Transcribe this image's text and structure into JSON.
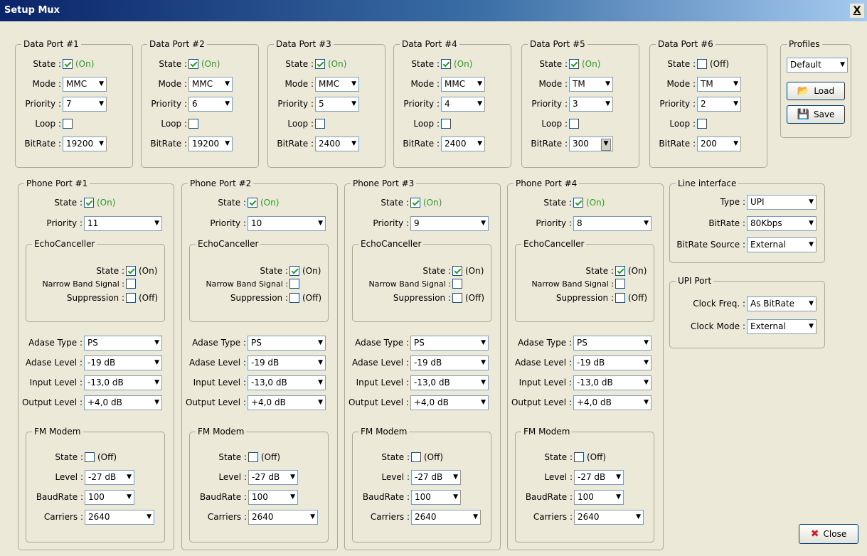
{
  "window": {
    "title": "Setup Mux",
    "close_glyph": "X"
  },
  "data_ports": [
    {
      "title": "Data Port #1",
      "state": "(On)",
      "state_checked": true,
      "mode": "MMC",
      "priority": "7",
      "bitrate": "19200"
    },
    {
      "title": "Data Port #2",
      "state": "(On)",
      "state_checked": true,
      "mode": "MMC",
      "priority": "6",
      "bitrate": "19200"
    },
    {
      "title": "Data Port #3",
      "state": "(On)",
      "state_checked": true,
      "mode": "MMC",
      "priority": "5",
      "bitrate": "2400"
    },
    {
      "title": "Data Port #4",
      "state": "(On)",
      "state_checked": true,
      "mode": "MMC",
      "priority": "4",
      "bitrate": "2400"
    },
    {
      "title": "Data Port #5",
      "state": "(On)",
      "state_checked": true,
      "mode": "TM",
      "priority": "3",
      "bitrate": "300"
    },
    {
      "title": "Data Port #6",
      "state": "(Off)",
      "state_checked": false,
      "mode": "TM",
      "priority": "2",
      "bitrate": "200"
    }
  ],
  "data_labels": {
    "state": "State :",
    "mode": "Mode :",
    "priority": "Priority :",
    "loop": "Loop :",
    "bitrate": "BitRate :"
  },
  "profiles": {
    "title": "Profiles",
    "selected": "Default",
    "load_label": "Load",
    "save_label": "Save"
  },
  "phone_ports": [
    {
      "title": "Phone Port #1",
      "state": "(On)",
      "priority": "11",
      "ec_state": "(On)",
      "suppression": "(Off)",
      "adase_type": "PS",
      "adase_level": "-19 dB",
      "input_level": "-13,0 dB",
      "output_level": "+4,0 dB",
      "fm_state": "(Off)",
      "fm_level": "-27 dB",
      "baudrate": "100",
      "carriers": "2640"
    },
    {
      "title": "Phone Port #2",
      "state": "(On)",
      "priority": "10",
      "ec_state": "(On)",
      "suppression": "(Off)",
      "adase_type": "PS",
      "adase_level": "-19 dB",
      "input_level": "-13,0 dB",
      "output_level": "+4,0 dB",
      "fm_state": "(Off)",
      "fm_level": "-27 dB",
      "baudrate": "100",
      "carriers": "2640"
    },
    {
      "title": "Phone Port #3",
      "state": "(On)",
      "priority": "9",
      "ec_state": "(On)",
      "suppression": "(Off)",
      "adase_type": "PS",
      "adase_level": "-19 dB",
      "input_level": "-13,0 dB",
      "output_level": "+4,0 dB",
      "fm_state": "(Off)",
      "fm_level": "-27 dB",
      "baudrate": "100",
      "carriers": "2640"
    },
    {
      "title": "Phone Port #4",
      "state": "(On)",
      "priority": "8",
      "ec_state": "(On)",
      "suppression": "(Off)",
      "adase_type": "PS",
      "adase_level": "-19 dB",
      "input_level": "-13,0 dB",
      "output_level": "+4,0 dB",
      "fm_state": "(Off)",
      "fm_level": "-27 dB",
      "baudrate": "100",
      "carriers": "2640"
    }
  ],
  "phone_labels": {
    "state": "State :",
    "priority": "Priority :",
    "echo_title": "EchoCanceller",
    "nb_signal": "Narrow Band Signal :",
    "suppression": "Suppression :",
    "adase_type": "Adase Type :",
    "adase_level": "Adase Level :",
    "input_level": "Input Level :",
    "output_level": "Output Level :",
    "fm_title": "FM Modem",
    "fm_level": "Level :",
    "baudrate": "BaudRate :",
    "carriers": "Carriers :"
  },
  "line_interface": {
    "title": "Line interface",
    "type_label": "Type :",
    "type": "UPI",
    "bitrate_label": "BitRate :",
    "bitrate": "80Kbps",
    "source_label": "BitRate Source :",
    "source": "External"
  },
  "upi_port": {
    "title": "UPI Port",
    "clock_freq_label": "Clock Freq. :",
    "clock_freq": "As BitRate",
    "clock_mode_label": "Clock Mode :",
    "clock_mode": "External"
  },
  "close_button": {
    "label": "Close"
  }
}
